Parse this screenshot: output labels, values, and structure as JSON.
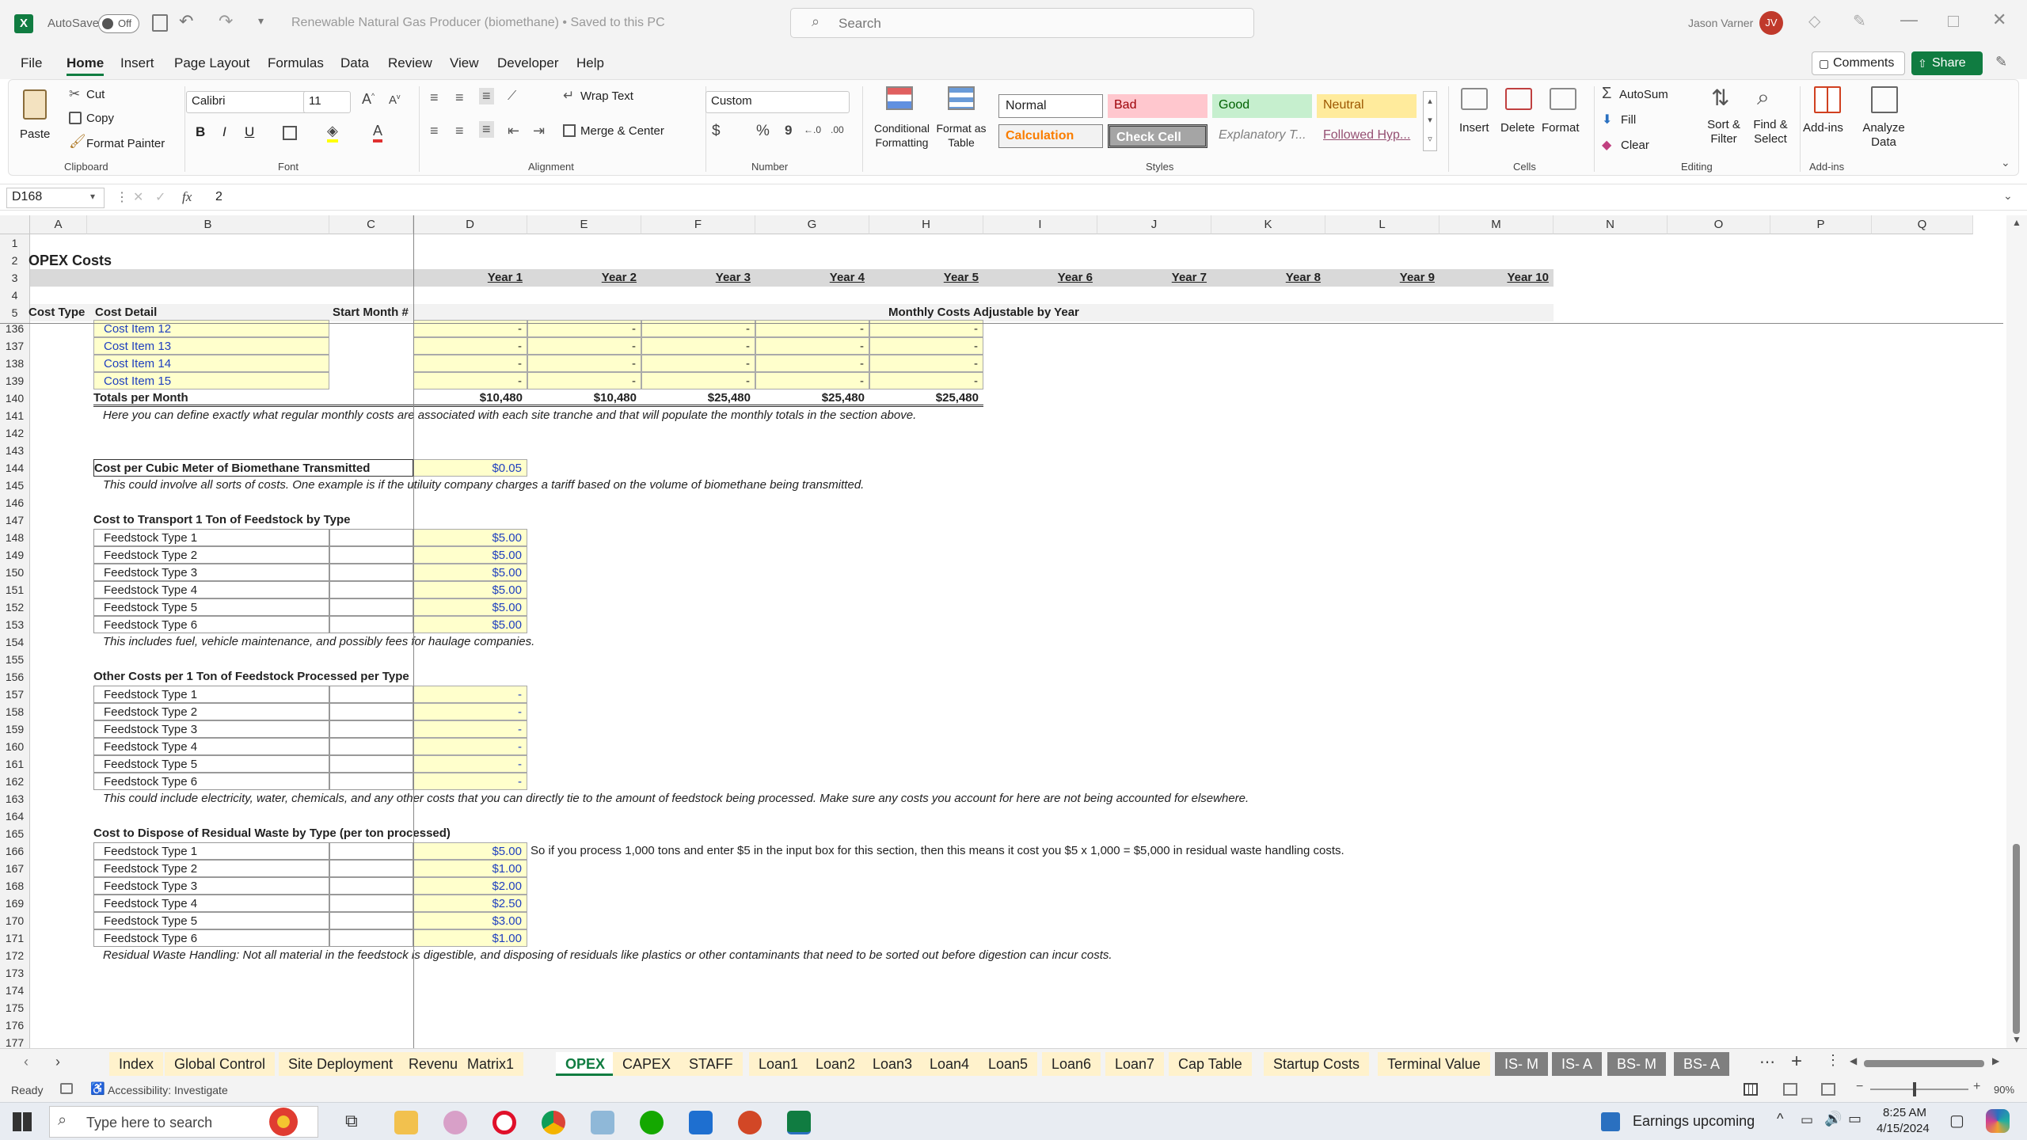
{
  "titlebar": {
    "autosave_label": "AutoSave",
    "autosave_state": "Off",
    "document_title": "Renewable Natural Gas Producer (biomethane) • Saved to this PC",
    "search_placeholder": "Search",
    "user_name": "Jason Varner",
    "user_initials": "JV"
  },
  "menu": [
    "File",
    "Home",
    "Insert",
    "Page Layout",
    "Formulas",
    "Data",
    "Review",
    "View",
    "Developer",
    "Help"
  ],
  "menu_active": "Home",
  "menu_right": {
    "comments": "Comments",
    "share": "Share"
  },
  "ribbon": {
    "clipboard": {
      "paste": "Paste",
      "cut": "Cut",
      "copy": "Copy",
      "format_painter": "Format Painter",
      "group": "Clipboard"
    },
    "font": {
      "name": "Calibri",
      "size": "11",
      "bold": "B",
      "italic": "I",
      "underline": "U",
      "group": "Font"
    },
    "alignment": {
      "wrap": "Wrap Text",
      "merge": "Merge & Center",
      "group": "Alignment"
    },
    "number": {
      "format": "Custom",
      "currency": "$",
      "percent": "%",
      "comma": "9",
      "group": "Number"
    },
    "styles": {
      "conditional": "Conditional Formatting",
      "format_table": "Format as Table",
      "cells": [
        "Normal",
        "Bad",
        "Good",
        "Neutral",
        "Calculation",
        "Check Cell",
        "Explanatory T...",
        "Followed Hyp..."
      ],
      "group": "Styles"
    },
    "cells": {
      "insert": "Insert",
      "delete": "Delete",
      "format": "Format",
      "group": "Cells"
    },
    "editing": {
      "autosum": "AutoSum",
      "fill": "Fill",
      "clear": "Clear",
      "sort": "Sort & Filter",
      "find": "Find & Select",
      "group": "Editing"
    },
    "addins": {
      "addins": "Add-ins",
      "analyze": "Analyze Data",
      "group": "Add-ins"
    }
  },
  "formula_bar": {
    "name_box": "D168",
    "fx": "fx",
    "value": "2"
  },
  "columns": [
    "A",
    "B",
    "C",
    "D",
    "E",
    "F",
    "G",
    "H",
    "I",
    "J",
    "K",
    "L",
    "M",
    "N",
    "O",
    "P",
    "Q"
  ],
  "sheet": {
    "title": "OPEX Costs",
    "years": [
      "Year 1",
      "Year 2",
      "Year 3",
      "Year 4",
      "Year 5",
      "Year 6",
      "Year 7",
      "Year 8",
      "Year 9",
      "Year 10"
    ],
    "header_cost_type": "Cost Type",
    "header_cost_detail": "Cost Detail",
    "header_start_month": "Start Month #",
    "header_monthly": "Monthly Costs Adjustable by Year",
    "cost_items": [
      "Cost Item 12",
      "Cost Item 13",
      "Cost Item 14",
      "Cost Item 15"
    ],
    "dash": "-",
    "totals_label": "Totals per Month",
    "totals": [
      "$10,480",
      "$10,480",
      "$25,480",
      "$25,480",
      "$25,480"
    ],
    "note_141": "Here you can define exactly what regular monthly costs are associated with each site tranche and that will populate the monthly totals in the section above.",
    "cubic_label": "Cost per Cubic Meter of Biomethane Transmitted",
    "cubic_value": "$0.05",
    "note_145": "This could involve all sorts of costs. One example is if the utiluity company charges a tariff based on the volume of biomethane being transmitted.",
    "transport_title": "Cost to Transport 1 Ton of Feedstock by Type",
    "feedstock_types": [
      "Feedstock Type 1",
      "Feedstock Type 2",
      "Feedstock Type 3",
      "Feedstock Type 4",
      "Feedstock Type 5",
      "Feedstock Type 6"
    ],
    "transport_values": [
      "$5.00",
      "$5.00",
      "$5.00",
      "$5.00",
      "$5.00",
      "$5.00"
    ],
    "note_154": "This includes fuel, vehicle maintenance, and possibly fees for haulage companies.",
    "other_title": "Other Costs per 1 Ton of Feedstock Processed per Type",
    "other_values": [
      "-",
      "-",
      "-",
      "-",
      "-",
      "-"
    ],
    "note_163": "This could include electricity, water, chemicals, and any other costs that you can directly tie to the amount of feedstock being processed. Make sure any costs you account for here are not being accounted for elsewhere.",
    "dispose_title": "Cost to Dispose of Residual Waste by Type (per ton processed)",
    "dispose_values": [
      "$5.00",
      "$1.00",
      "$2.00",
      "$2.50",
      "$3.00",
      "$1.00"
    ],
    "note_166": "So if you process 1,000 tons and enter $5 in the input box for this section, then this means it cost you $5 x 1,000  = $5,000 in residual waste handling costs.",
    "note_172": "Residual Waste Handling: Not all material in the feedstock is digestible, and disposing of residuals like plastics or other contaminants that need to be sorted out before digestion can incur costs."
  },
  "rows": [
    "1",
    "2",
    "3",
    "4",
    "5",
    "136",
    "137",
    "138",
    "139",
    "140",
    "141",
    "142",
    "143",
    "144",
    "145",
    "146",
    "147",
    "148",
    "149",
    "150",
    "151",
    "152",
    "153",
    "154",
    "155",
    "156",
    "157",
    "158",
    "159",
    "160",
    "161",
    "162",
    "163",
    "164",
    "165",
    "166",
    "167",
    "168",
    "169",
    "170",
    "171",
    "172",
    "173",
    "174",
    "175",
    "176",
    "177"
  ],
  "tabs": [
    "Index",
    "Global Control",
    "Site Deployment",
    "Revenue",
    "Matrix1",
    "OPEX",
    "CAPEX",
    "STAFF",
    "Loan1",
    "Loan2",
    "Loan3",
    "Loan4",
    "Loan5",
    "Loan6",
    "Loan7",
    "Cap Table",
    "Startup Costs",
    "Terminal Value",
    "IS- M",
    "IS- A",
    "BS- M",
    "BS- A"
  ],
  "active_tab": "OPEX",
  "status": {
    "ready": "Ready",
    "accessibility": "Accessibility: Investigate",
    "zoom": "90%"
  },
  "taskbar": {
    "search_placeholder": "Type here to search",
    "news": "Earnings upcoming",
    "time": "8:25 AM",
    "date": "4/15/2024"
  }
}
